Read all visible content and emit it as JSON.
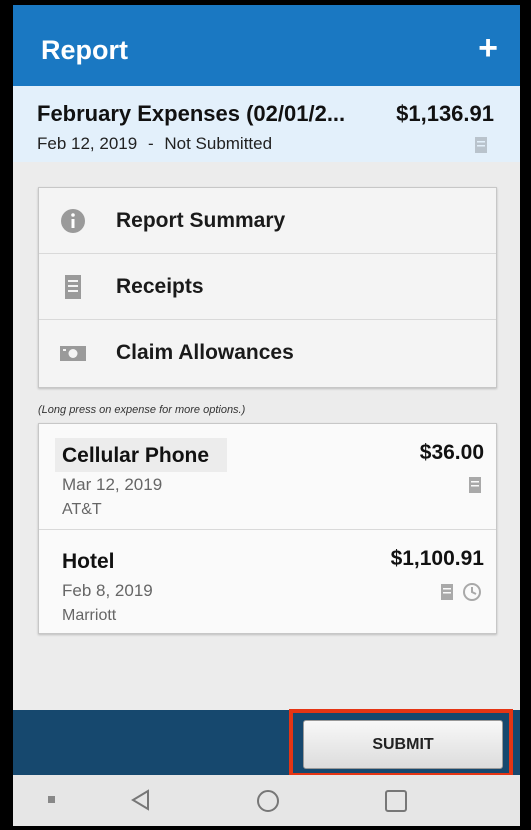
{
  "header": {
    "title": "Report",
    "add_icon": "plus-icon"
  },
  "report": {
    "name": "February Expenses (02/01/2...",
    "total": "$1,136.91",
    "date": "Feb 12, 2019",
    "separator": "-",
    "status": "Not Submitted"
  },
  "menu": {
    "items": [
      {
        "label": "Report Summary",
        "icon": "info-icon"
      },
      {
        "label": "Receipts",
        "icon": "receipt-icon"
      },
      {
        "label": "Claim Allowances",
        "icon": "money-icon"
      }
    ]
  },
  "hint": "(Long press on expense for more options.)",
  "expenses": [
    {
      "name": "Cellular Phone",
      "amount": "$36.00",
      "date": "Mar 12, 2019",
      "vendor": "AT&T"
    },
    {
      "name": "Hotel",
      "amount": "$1,100.91",
      "date": "Feb 8, 2019",
      "vendor": "Marriott"
    }
  ],
  "actions": {
    "submit_label": "SUBMIT"
  },
  "colors": {
    "appbar": "#1a78c2",
    "banner": "#e3f0fb",
    "actionbar": "#16486e",
    "highlight": "#e53514"
  },
  "nav": [
    "menu-dot-icon",
    "back-icon",
    "home-icon",
    "recents-icon"
  ]
}
